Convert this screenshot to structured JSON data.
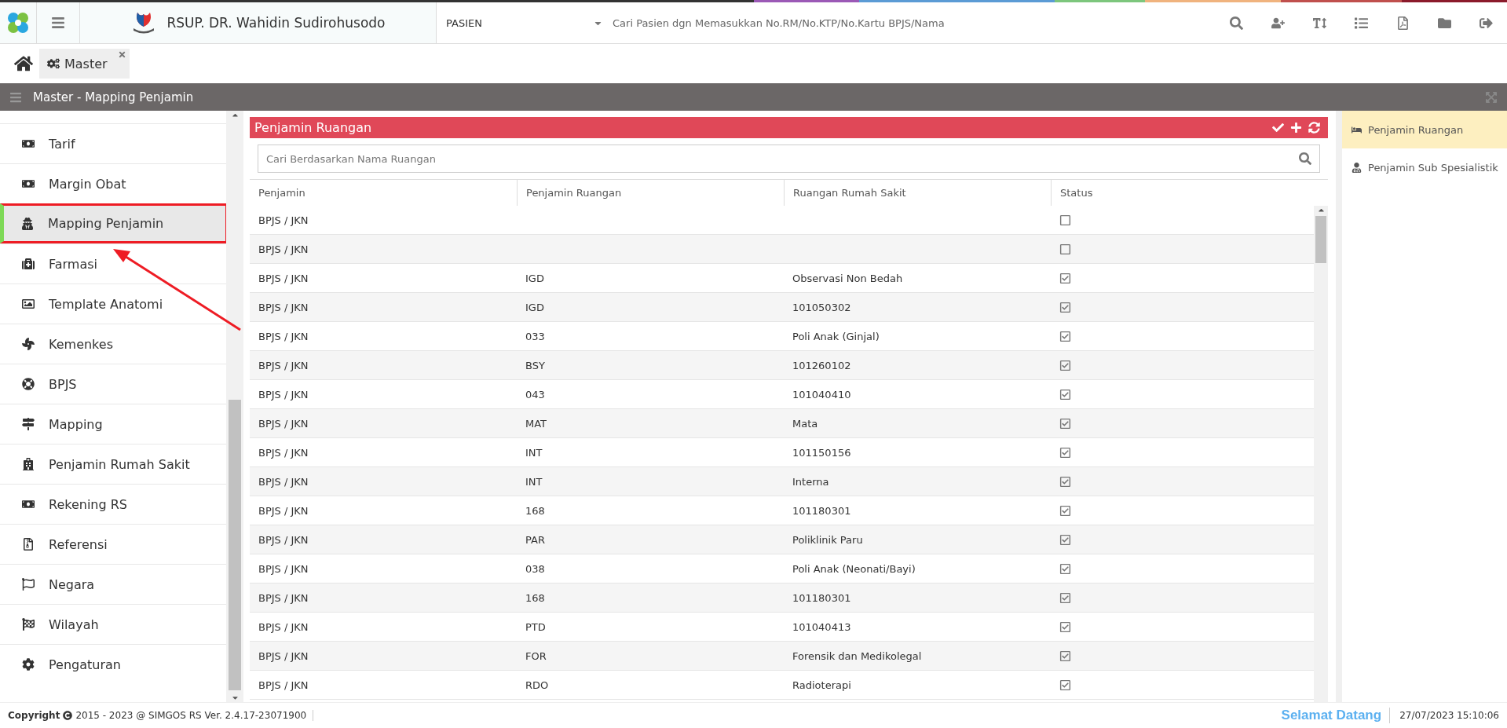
{
  "topbar": {
    "hospital_name": "RSUP. DR. Wahidin Sudirohusodo",
    "search_type": "PASIEN",
    "search_placeholder": "Cari Pasien dgn Memasukkan No.RM/No.KTP/No.Kartu BPJS/Nama"
  },
  "tabs": [
    {
      "label": "Master",
      "selected": true
    }
  ],
  "page_title": "Master - Mapping Penjamin",
  "sidebar": {
    "items": [
      {
        "label": "Tarif",
        "selected": false
      },
      {
        "label": "Margin Obat",
        "selected": false
      },
      {
        "label": "Mapping Penjamin",
        "selected": true
      },
      {
        "label": "Farmasi",
        "selected": false
      },
      {
        "label": "Template Anatomi",
        "selected": false
      },
      {
        "label": "Kemenkes",
        "selected": false
      },
      {
        "label": "BPJS",
        "selected": false
      },
      {
        "label": "Mapping",
        "selected": false
      },
      {
        "label": "Penjamin Rumah Sakit",
        "selected": false
      },
      {
        "label": "Rekening RS",
        "selected": false
      },
      {
        "label": "Referensi",
        "selected": false
      },
      {
        "label": "Negara",
        "selected": false
      },
      {
        "label": "Wilayah",
        "selected": false
      },
      {
        "label": "Pengaturan",
        "selected": false
      }
    ]
  },
  "panel": {
    "title": "Penjamin Ruangan",
    "search_placeholder": "Cari Berdasarkan Nama Ruangan",
    "columns": [
      "Penjamin",
      "Penjamin Ruangan",
      "Ruangan Rumah Sakit",
      "Status"
    ],
    "rows": [
      {
        "penjamin": "BPJS / JKN",
        "checked": false
      },
      {
        "penjamin": "BPJS / JKN",
        "checked": false
      },
      {
        "penjamin": "BPJS / JKN",
        "penjamin_ruangan": "IGD",
        "ruangan": "Observasi Non Bedah",
        "checked": true
      },
      {
        "penjamin": "BPJS / JKN",
        "penjamin_ruangan": "IGD",
        "ruangan": "101050302",
        "checked": true
      },
      {
        "penjamin": "BPJS / JKN",
        "penjamin_ruangan": "033",
        "ruangan": "Poli Anak (Ginjal)",
        "checked": true
      },
      {
        "penjamin": "BPJS / JKN",
        "penjamin_ruangan": "BSY",
        "ruangan": "101260102",
        "checked": true
      },
      {
        "penjamin": "BPJS / JKN",
        "penjamin_ruangan": "043",
        "ruangan": "101040410",
        "checked": true
      },
      {
        "penjamin": "BPJS / JKN",
        "penjamin_ruangan": "MAT",
        "ruangan": "Mata",
        "checked": true
      },
      {
        "penjamin": "BPJS / JKN",
        "penjamin_ruangan": "INT",
        "ruangan": "101150156",
        "checked": true
      },
      {
        "penjamin": "BPJS / JKN",
        "penjamin_ruangan": "INT",
        "ruangan": "Interna",
        "checked": true
      },
      {
        "penjamin": "BPJS / JKN",
        "penjamin_ruangan": "168",
        "ruangan": "101180301",
        "checked": true
      },
      {
        "penjamin": "BPJS / JKN",
        "penjamin_ruangan": "PAR",
        "ruangan": "Poliklinik Paru",
        "checked": true
      },
      {
        "penjamin": "BPJS / JKN",
        "penjamin_ruangan": "038",
        "ruangan": "Poli Anak (Neonati/Bayi)",
        "checked": true
      },
      {
        "penjamin": "BPJS / JKN",
        "penjamin_ruangan": "168",
        "ruangan": "101180301",
        "checked": true
      },
      {
        "penjamin": "BPJS / JKN",
        "penjamin_ruangan": "PTD",
        "ruangan": "101040413",
        "checked": true
      },
      {
        "penjamin": "BPJS / JKN",
        "penjamin_ruangan": "FOR",
        "ruangan": "Forensik dan Medikolegal",
        "checked": true
      },
      {
        "penjamin": "BPJS / JKN",
        "penjamin_ruangan": "RDO",
        "ruangan": "Radioterapi",
        "checked": true
      }
    ]
  },
  "right_menu": [
    {
      "label": "Penjamin Ruangan",
      "selected": true
    },
    {
      "label": "Penjamin Sub Spesialistik",
      "selected": false
    }
  ],
  "footer": {
    "copyright_label": "Copyright",
    "copyright_text": "2015 - 2023 @ SIMGOS RS Ver. 2.4.17-23071900",
    "welcome": "Selamat Datang",
    "datetime": "27/07/2023 15:10:06"
  }
}
